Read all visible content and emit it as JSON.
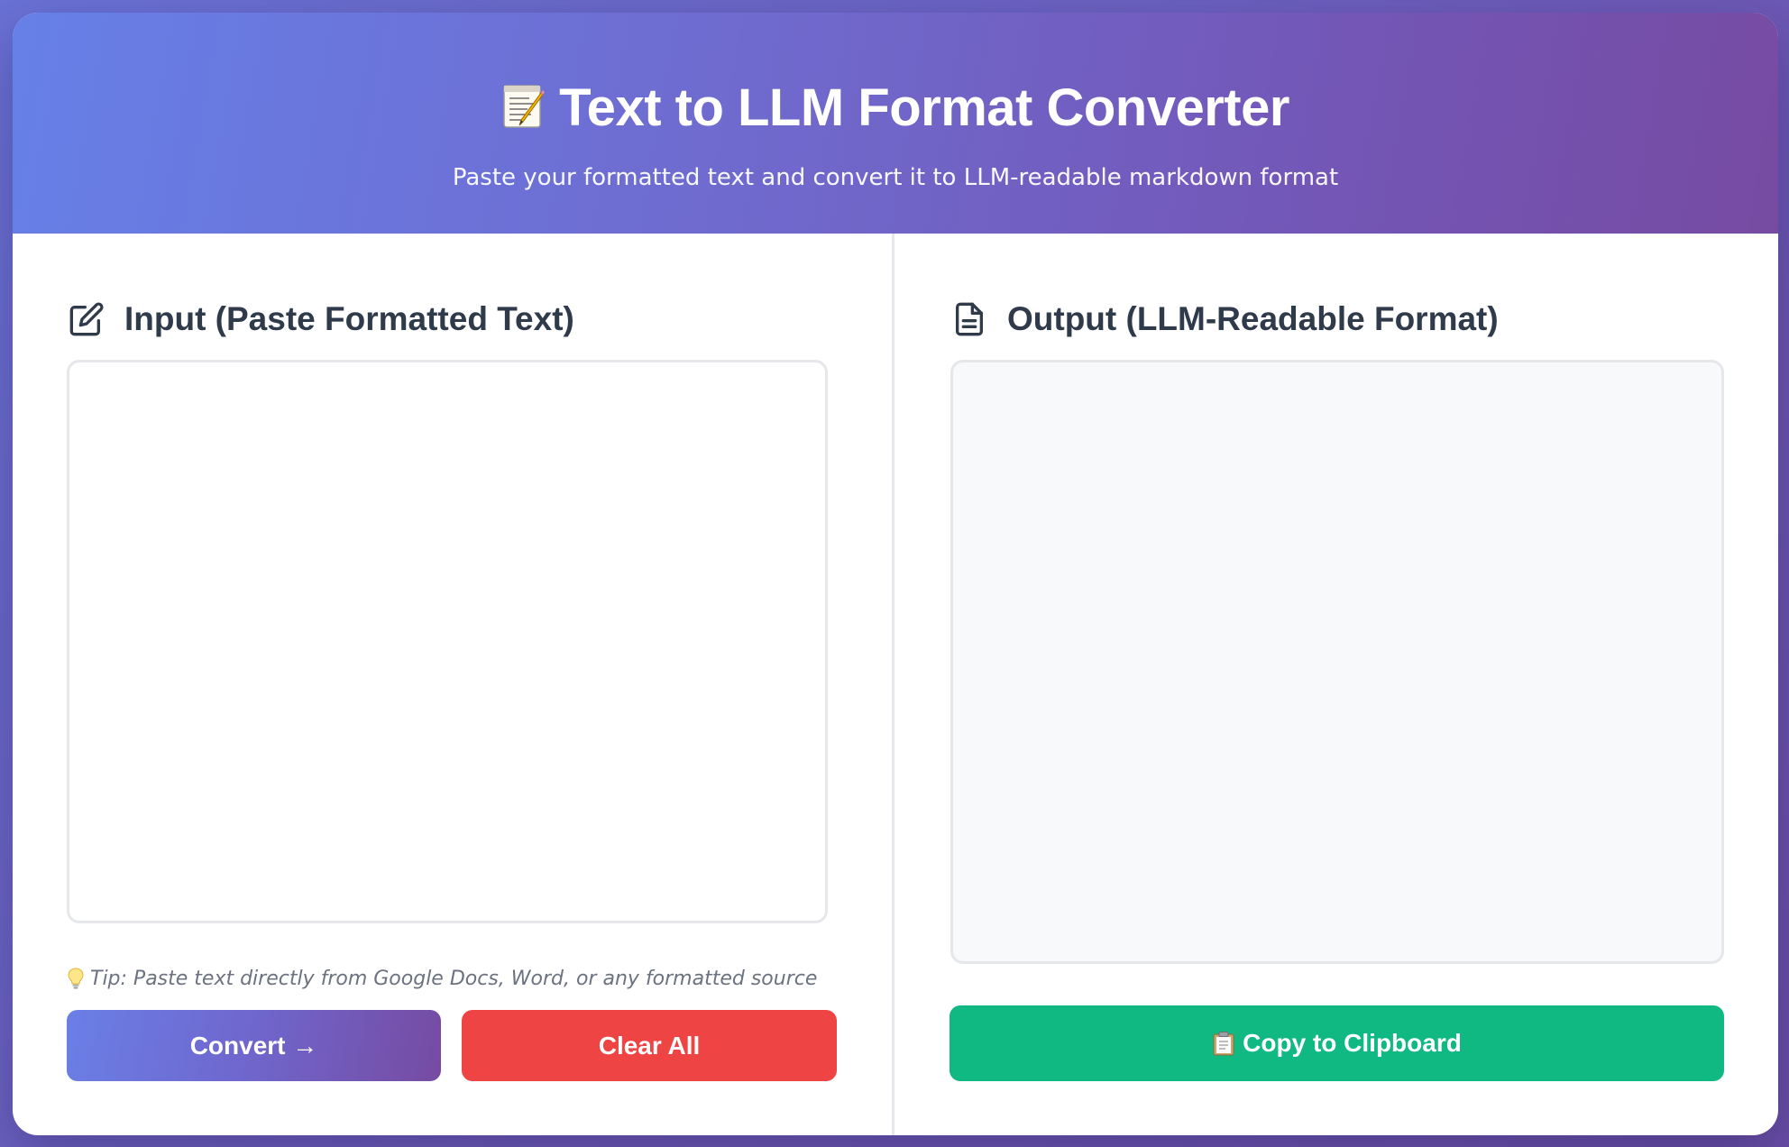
{
  "header": {
    "title": "Text to LLM Format Converter",
    "title_icon": "memo-emoji-icon",
    "subtitle": "Paste your formatted text and convert it to LLM-readable markdown format"
  },
  "input_panel": {
    "heading": "Input (Paste Formatted Text)",
    "heading_icon": "edit-icon",
    "textarea_value": "",
    "tip_icon": "lightbulb-icon",
    "tip": "Tip: Paste text directly from Google Docs, Word, or any formatted source",
    "convert_label": "Convert →",
    "clear_label": "Clear All"
  },
  "output_panel": {
    "heading": "Output (LLM-Readable Format)",
    "heading_icon": "document-icon",
    "output_value": "",
    "copy_icon": "clipboard-icon",
    "copy_label": "Copy to Clipboard"
  },
  "colors": {
    "header_gradient_start": "#667eea",
    "header_gradient_end": "#764ba2",
    "heading_text": "#2f3a4a",
    "clear_button": "#ef4444",
    "copy_button": "#10b981",
    "tip_text": "#6b7280"
  }
}
